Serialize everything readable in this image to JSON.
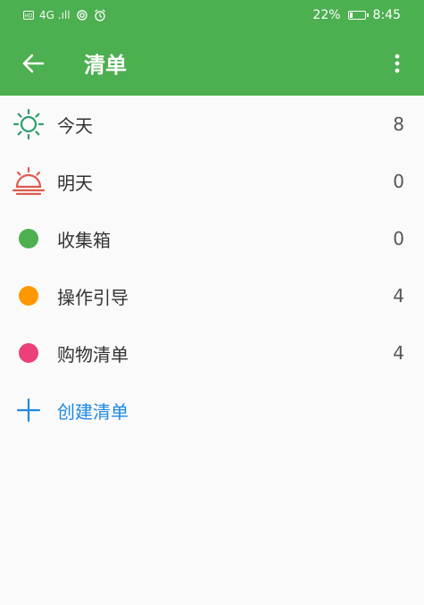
{
  "status_bar": {
    "left_indicators": "4G .ıll",
    "battery_percent": "22%",
    "time": "8:45",
    "battery_level": 0.22
  },
  "app_bar": {
    "title": "清单",
    "back_icon": "arrow-left-icon",
    "menu_icon": "more-vertical-icon",
    "color": "#4caf50"
  },
  "lists": [
    {
      "label": "今天",
      "count": "8",
      "icon": "sun-icon",
      "color": "#2e9e6b"
    },
    {
      "label": "明天",
      "count": "0",
      "icon": "sunrise-icon",
      "color": "#e05a4e"
    },
    {
      "label": "收集箱",
      "count": "0",
      "icon": "dot-icon",
      "color": "#4caf50"
    },
    {
      "label": "操作引导",
      "count": "4",
      "icon": "dot-icon",
      "color": "#ff9800"
    },
    {
      "label": "购物清单",
      "count": "4",
      "icon": "dot-icon",
      "color": "#ec407a"
    }
  ],
  "create": {
    "label": "创建清单",
    "icon": "plus-icon",
    "color": "#1e88e5"
  }
}
